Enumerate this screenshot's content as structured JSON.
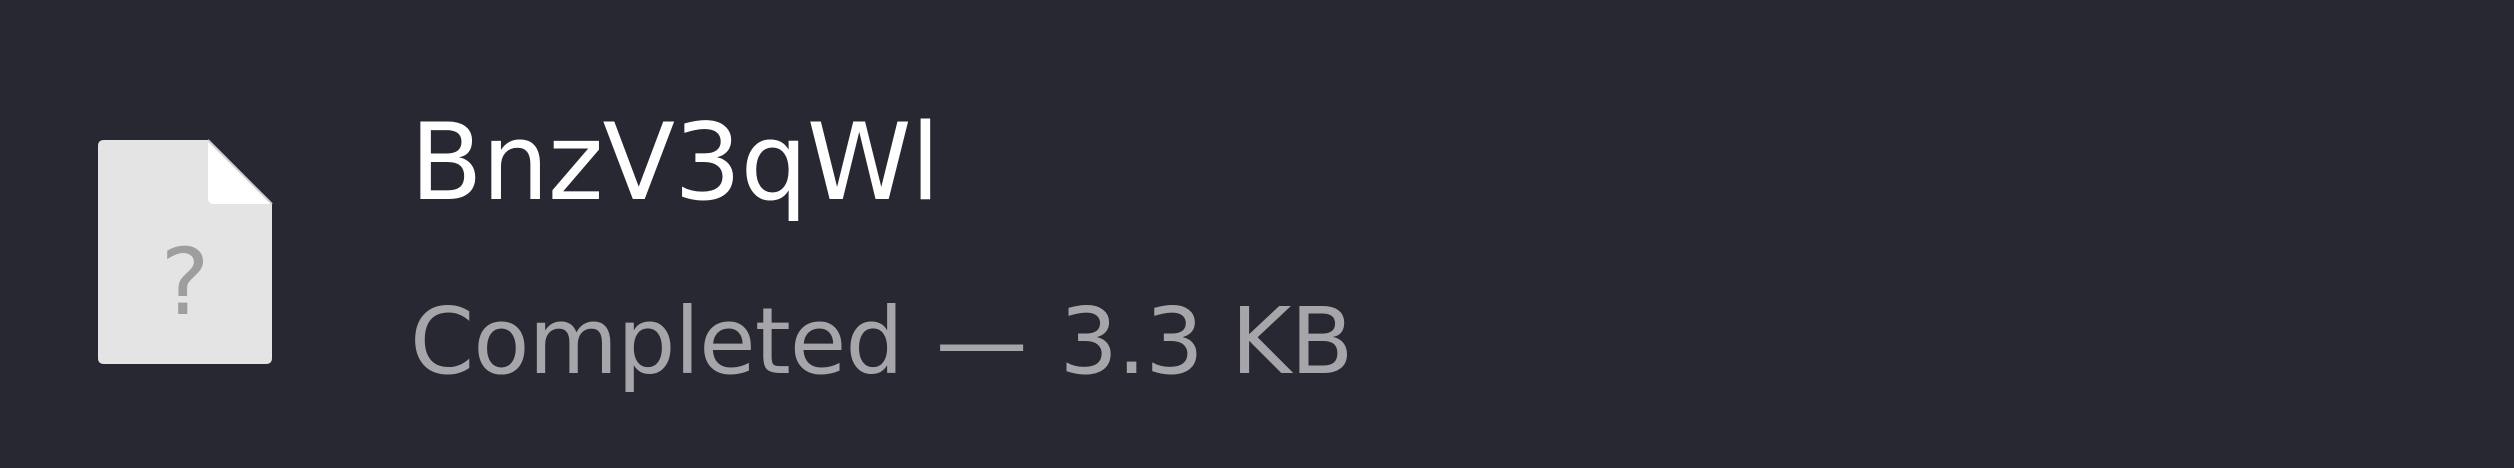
{
  "download": {
    "icon": "unknown-file-icon",
    "icon_glyph": "?",
    "filename": "BnzV3qWl",
    "status": "Completed",
    "separator": "—",
    "size": "3.3 KB"
  },
  "colors": {
    "background": "#272831",
    "filename_text": "#ffffff",
    "status_text": "#a6a6aa",
    "icon_fill": "#e4e4e4",
    "icon_glyph": "#9e9e9e"
  }
}
